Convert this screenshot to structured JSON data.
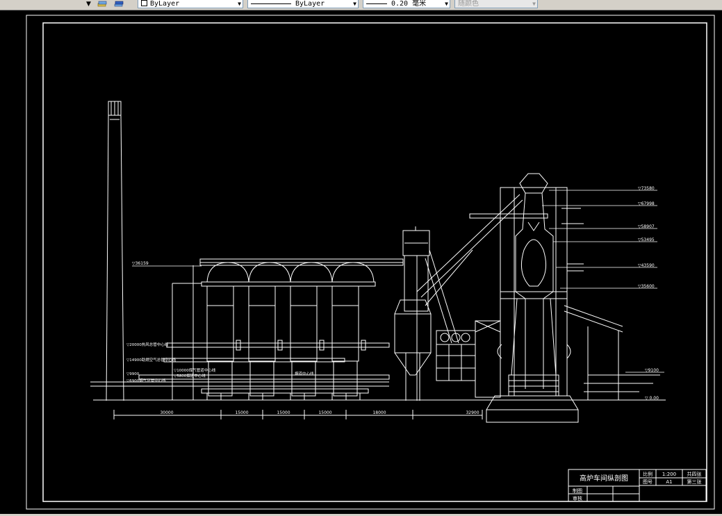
{
  "toolbar": {
    "layer_color": "ByLayer",
    "linetype": "ByLayer",
    "lineweight": "0.20 毫米",
    "plot_style": "随颜色"
  },
  "dimensions": [
    "30000",
    "15000",
    "15000",
    "15000",
    "18000",
    "32900"
  ],
  "elevations": {
    "e1": "▽73580",
    "e2": "▽67998",
    "e3": "▽58907",
    "e4": "▽53495",
    "e5": "▽43590",
    "e6": "▽35600",
    "e7": "▽9100",
    "e8": "▽ 0.00",
    "left": "▽36159"
  },
  "pipe_labels": {
    "p1": "▽20000热风总管中心线",
    "p2": "▽14900助燃空气总管中心线",
    "p3": "▽9900",
    "p4": "▽6900烟气总管中心线",
    "p5": "▽10000煤气管道中心线",
    "p6": "▽5800烟道中心线",
    "p7": "烟道中心线"
  },
  "title_block": {
    "drawing_title": "高炉车间纵剖图",
    "scale_label": "比例",
    "scale_value": "1:200",
    "total_sheets": "共四张",
    "sheet_label": "图号",
    "sheet_value": "A1",
    "sheet_no": "第三张",
    "drawn_by": "制图",
    "reviewed_by": "审核"
  }
}
